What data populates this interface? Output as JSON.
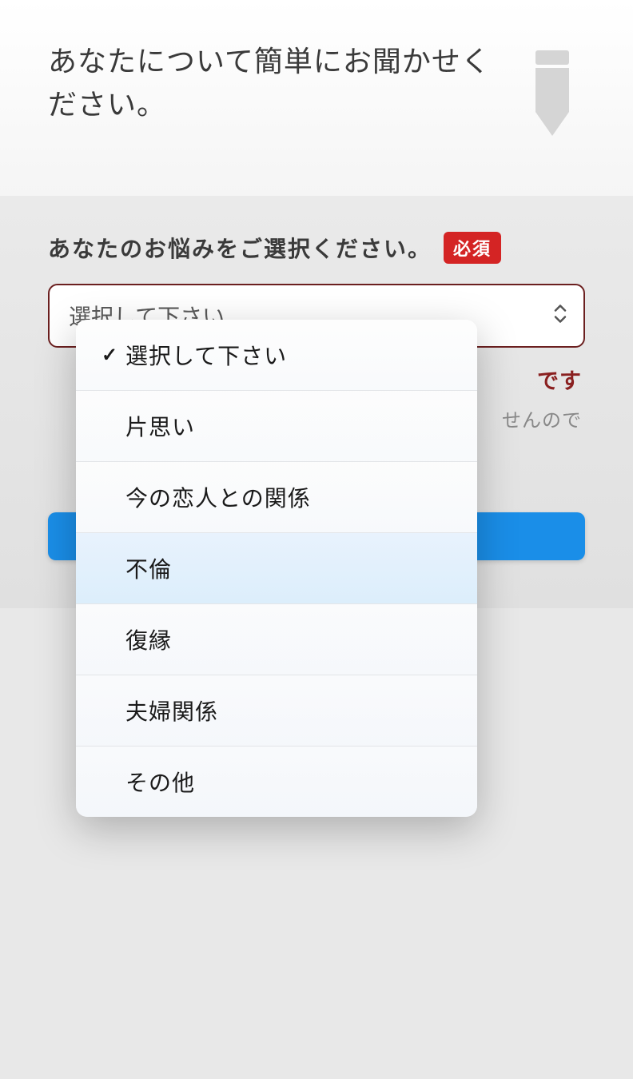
{
  "header": {
    "title": "あなたについて簡単にお聞かせください。"
  },
  "field": {
    "label": "あなたのお悩みをご選択ください。",
    "required_badge": "必須",
    "placeholder": "選択して下さい",
    "subtext_end1": "です",
    "subtext_end2": "せんので"
  },
  "dropdown": {
    "options": [
      {
        "label": "選択して下さい",
        "checked": true
      },
      {
        "label": "片思い",
        "checked": false
      },
      {
        "label": "今の恋人との関係",
        "checked": false
      },
      {
        "label": "不倫",
        "checked": false
      },
      {
        "label": "復縁",
        "checked": false
      },
      {
        "label": "夫婦関係",
        "checked": false
      },
      {
        "label": "その他",
        "checked": false
      }
    ]
  }
}
